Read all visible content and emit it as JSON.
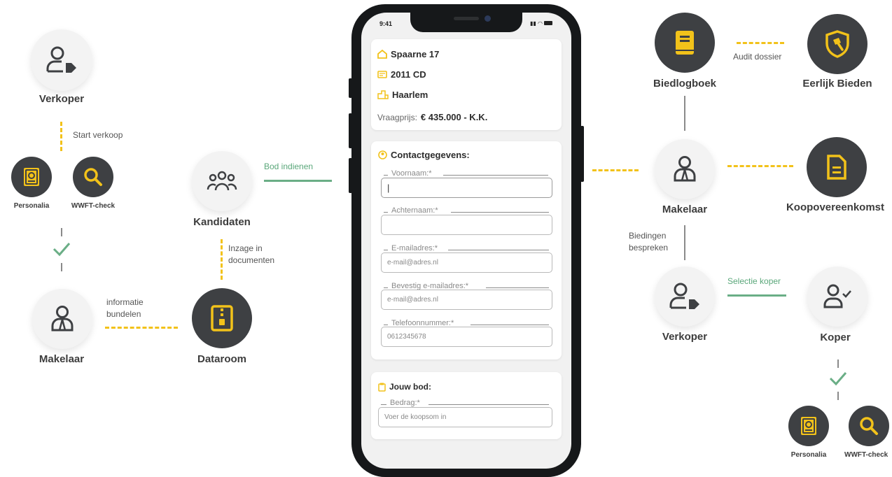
{
  "colors": {
    "accent": "#f2c21a",
    "dark": "#3e4043",
    "green": "#6aae86",
    "text": "#3c3c3c"
  },
  "left": {
    "verkoper": "Verkoper",
    "start_verkoop": "Start verkoop",
    "personalia": "Personalia",
    "wwft_check": "WWFT-check",
    "makelaar": "Makelaar",
    "informatie_bundelen": [
      "informatie",
      "bundelen"
    ],
    "dataroom": "Dataroom",
    "kandidaten": "Kandidaten",
    "inzage": [
      "Inzage in",
      "documenten"
    ],
    "bod_indienen": "Bod indienen"
  },
  "phone": {
    "time": "9:41",
    "address": {
      "street": "Spaarne 17",
      "postcode": "2011 CD",
      "city": "Haarlem",
      "price_label": "Vraagprijs:",
      "price_value": "€ 435.000 - K.K."
    },
    "contact": {
      "title": "Contactgegevens:",
      "fields": [
        {
          "label": "Voornaam:*",
          "placeholder": ""
        },
        {
          "label": "Achternaam:*",
          "placeholder": ""
        },
        {
          "label": "E-mailadres:*",
          "placeholder": "e-mail@adres.nl"
        },
        {
          "label": "Bevestig e-mailadres:*",
          "placeholder": "e-mail@adres.nl"
        },
        {
          "label": "Telefoonnummer:*",
          "placeholder": "0612345678"
        }
      ]
    },
    "bod": {
      "title": "Jouw bod:",
      "label": "Bedrag:*",
      "placeholder": "Voer de koopsom in"
    }
  },
  "right": {
    "biedlogboek": "Biedlogboek",
    "audit_dossier": "Audit dossier",
    "eerlijk_bieden": "Eerlijk Bieden",
    "makelaar": "Makelaar",
    "koopovereenkomst": "Koopovereenkomst",
    "biedingen_bespreken": [
      "Biedingen",
      "bespreken"
    ],
    "verkoper": "Verkoper",
    "selectie_koper": "Selectie koper",
    "koper": "Koper",
    "personalia": "Personalia",
    "wwft_check": "WWFT-check"
  }
}
